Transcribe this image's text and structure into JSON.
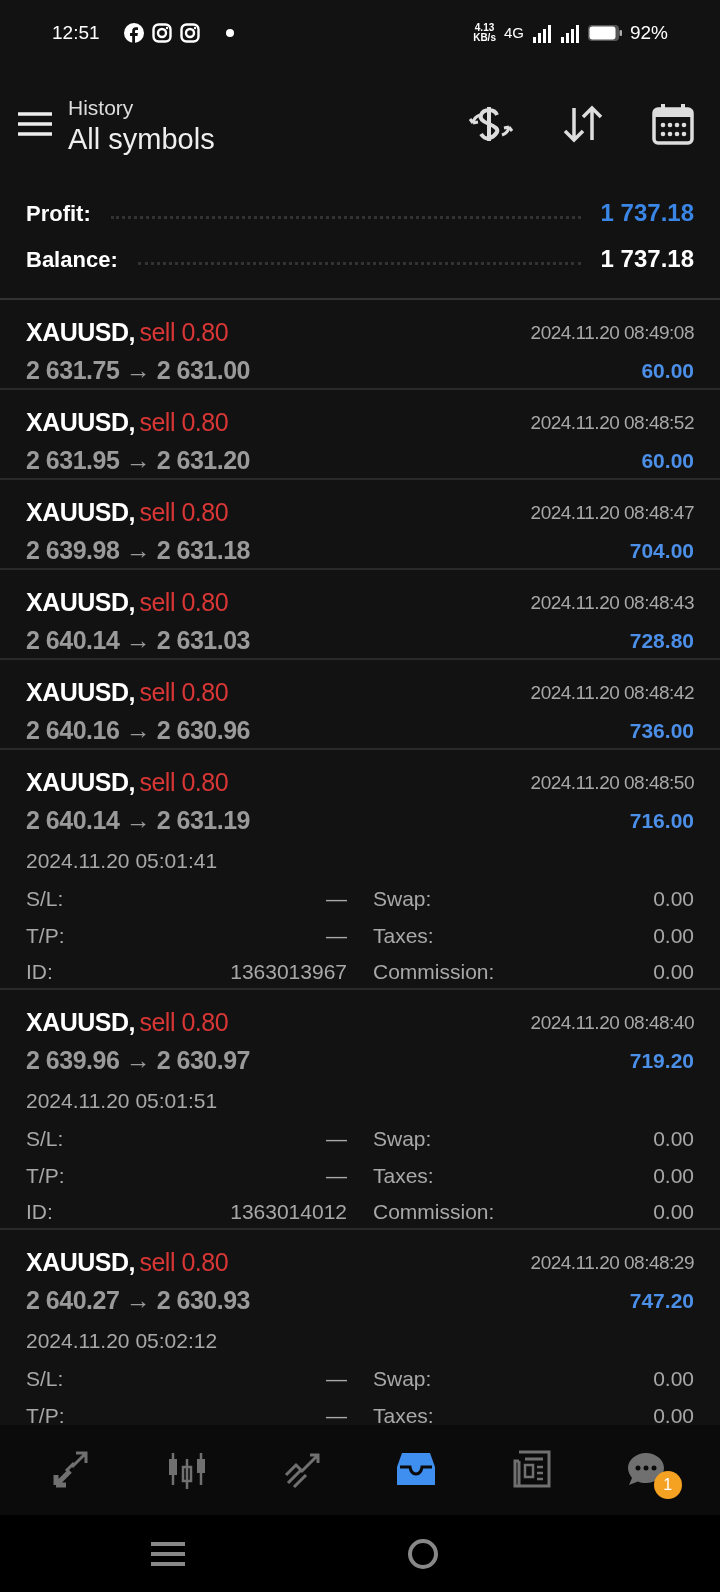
{
  "status_bar": {
    "time": "12:51",
    "net_speed": "4.13",
    "net_unit": "KB/s",
    "network": "4G",
    "battery": "92%"
  },
  "header": {
    "title": "History",
    "subtitle": "All symbols"
  },
  "summary": [
    {
      "label": "Profit:",
      "value": "1 737.18",
      "kind": "profit"
    },
    {
      "label": "Balance:",
      "value": "1 737.18",
      "kind": "balance"
    }
  ],
  "trades": [
    {
      "symbol": "XAUUSD,",
      "side": "sell 0.80",
      "prices": "2 631.75 → 2 631.00",
      "close_time": "2024.11.20 08:49:08",
      "profit": "60.00",
      "expanded": false
    },
    {
      "symbol": "XAUUSD,",
      "side": "sell 0.80",
      "prices": "2 631.95 → 2 631.20",
      "close_time": "2024.11.20 08:48:52",
      "profit": "60.00",
      "expanded": false
    },
    {
      "symbol": "XAUUSD,",
      "side": "sell 0.80",
      "prices": "2 639.98 → 2 631.18",
      "close_time": "2024.11.20 08:48:47",
      "profit": "704.00",
      "expanded": false
    },
    {
      "symbol": "XAUUSD,",
      "side": "sell 0.80",
      "prices": "2 640.14 → 2 631.03",
      "close_time": "2024.11.20 08:48:43",
      "profit": "728.80",
      "expanded": false
    },
    {
      "symbol": "XAUUSD,",
      "side": "sell 0.80",
      "prices": "2 640.16 → 2 630.96",
      "close_time": "2024.11.20 08:48:42",
      "profit": "736.00",
      "expanded": false
    },
    {
      "symbol": "XAUUSD,",
      "side": "sell 0.80",
      "prices": "2 640.14 → 2 631.19",
      "close_time": "2024.11.20 08:48:50",
      "profit": "716.00",
      "expanded": true,
      "open_time": "2024.11.20 05:01:41",
      "details": [
        {
          "label": "S/L:",
          "value": "—"
        },
        {
          "label": "Swap:",
          "value": "0.00"
        },
        {
          "label": "T/P:",
          "value": "—"
        },
        {
          "label": "Taxes:",
          "value": "0.00"
        },
        {
          "label": "ID:",
          "value": "1363013967"
        },
        {
          "label": "Commission:",
          "value": "0.00"
        }
      ]
    },
    {
      "symbol": "XAUUSD,",
      "side": "sell 0.80",
      "prices": "2 639.96 → 2 630.97",
      "close_time": "2024.11.20 08:48:40",
      "profit": "719.20",
      "expanded": true,
      "open_time": "2024.11.20 05:01:51",
      "details": [
        {
          "label": "S/L:",
          "value": "—"
        },
        {
          "label": "Swap:",
          "value": "0.00"
        },
        {
          "label": "T/P:",
          "value": "—"
        },
        {
          "label": "Taxes:",
          "value": "0.00"
        },
        {
          "label": "ID:",
          "value": "1363014012"
        },
        {
          "label": "Commission:",
          "value": "0.00"
        }
      ]
    },
    {
      "symbol": "XAUUSD,",
      "side": "sell 0.80",
      "prices": "2 640.27 → 2 630.93",
      "close_time": "2024.11.20 08:48:29",
      "profit": "747.20",
      "expanded": true,
      "open_time": "2024.11.20 05:02:12",
      "details": [
        {
          "label": "S/L:",
          "value": "—"
        },
        {
          "label": "Swap:",
          "value": "0.00"
        },
        {
          "label": "T/P:",
          "value": "—"
        },
        {
          "label": "Taxes:",
          "value": "0.00"
        }
      ]
    }
  ],
  "bottom_nav": [
    {
      "kind": "quotes",
      "selected": false
    },
    {
      "kind": "chart",
      "selected": false
    },
    {
      "kind": "trade",
      "selected": false
    },
    {
      "kind": "history",
      "selected": true
    },
    {
      "kind": "news",
      "selected": false
    },
    {
      "kind": "chat",
      "selected": false,
      "badge": "1"
    }
  ]
}
